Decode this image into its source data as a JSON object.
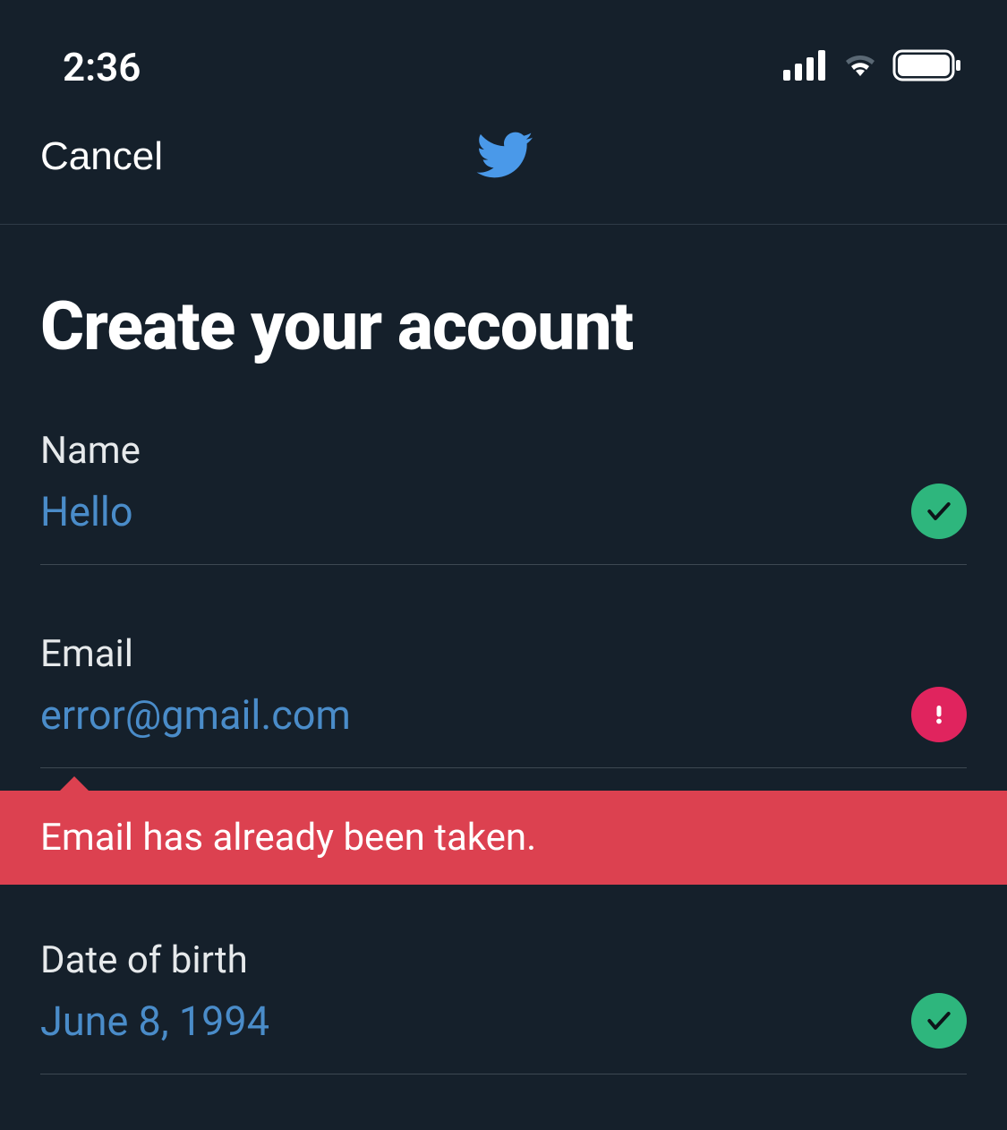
{
  "status_bar": {
    "time": "2:36"
  },
  "nav": {
    "cancel_label": "Cancel"
  },
  "page": {
    "title": "Create your account"
  },
  "form": {
    "name": {
      "label": "Name",
      "value": "Hello",
      "status": "valid"
    },
    "email": {
      "label": "Email",
      "value": "error@gmail.com",
      "status": "error",
      "error_message": "Email has already been taken."
    },
    "dob": {
      "label": "Date of birth",
      "value": "June 8, 1994",
      "status": "valid"
    }
  },
  "colors": {
    "background": "#15202b",
    "accent": "#4a8cc9",
    "success": "#2eb67d",
    "error_icon": "#e0245e",
    "error_banner": "#dc4150"
  }
}
